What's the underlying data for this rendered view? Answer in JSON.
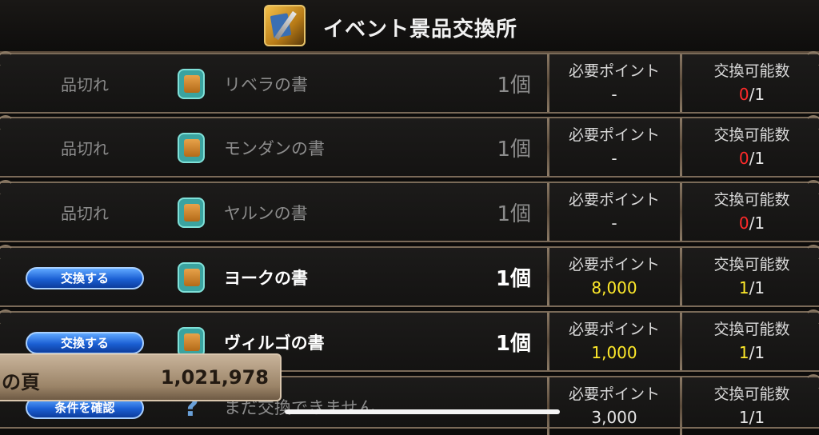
{
  "header": {
    "title": "イベント景品交換所",
    "icon": "event-exchange-icon"
  },
  "rows": [
    {
      "status": "品切れ",
      "item": "リベラの書",
      "qty": "1個",
      "points_label": "必要ポイント",
      "points": "-",
      "count_label": "交換可能数",
      "count_have": "0",
      "count_sep": "/1"
    },
    {
      "status": "品切れ",
      "item": "モンダンの書",
      "qty": "1個",
      "points_label": "必要ポイント",
      "points": "-",
      "count_label": "交換可能数",
      "count_have": "0",
      "count_sep": "/1"
    },
    {
      "status": "品切れ",
      "item": "ヤルンの書",
      "qty": "1個",
      "points_label": "必要ポイント",
      "points": "-",
      "count_label": "交換可能数",
      "count_have": "0",
      "count_sep": "/1"
    },
    {
      "button": "交換する",
      "item": "ヨークの書",
      "qty": "1個",
      "points_label": "必要ポイント",
      "points": "8,000",
      "count_label": "交換可能数",
      "count_have": "1",
      "count_sep": "/1"
    },
    {
      "button": "交換する",
      "item": "ヴィルゴの書",
      "qty": "1個",
      "points_label": "必要ポイント",
      "points": "1,000",
      "count_label": "交換可能数",
      "count_have": "1",
      "count_sep": "/1"
    },
    {
      "button": "条件を確認",
      "item": "まだ交換できません",
      "points_label": "必要ポイント",
      "points": "3,000",
      "count_label": "交換可能数",
      "count_have": "1",
      "count_sep": "/1"
    }
  ],
  "overlay": {
    "label": "の頁",
    "value": "1,021,978"
  },
  "colors": {
    "sold_out_count": "#ff2a2a",
    "available": "#ffea2a",
    "button": "#1b5fd3"
  }
}
